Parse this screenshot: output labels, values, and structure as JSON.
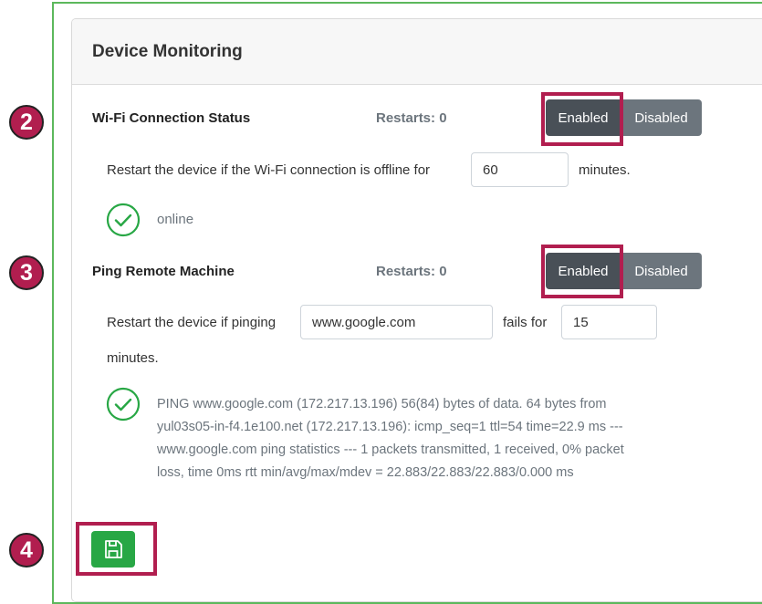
{
  "card": {
    "title": "Device Monitoring"
  },
  "wifi": {
    "title": "Wi-Fi Connection Status",
    "restarts_label": "Restarts: 0",
    "enabled_label": "Enabled",
    "disabled_label": "Disabled",
    "sentence_prefix": "Restart the device if the Wi-Fi connection is offline for",
    "minutes_value": "60",
    "sentence_suffix": "minutes.",
    "status_text": "online"
  },
  "ping": {
    "title": "Ping Remote Machine",
    "restarts_label": "Restarts: 0",
    "enabled_label": "Enabled",
    "disabled_label": "Disabled",
    "sentence_prefix": "Restart the device if pinging",
    "host_value": "www.google.com",
    "fails_label": "fails for",
    "fails_value": "15",
    "minutes_label": "minutes.",
    "result_text": "PING www.google.com (172.217.13.196) 56(84) bytes of data. 64 bytes from yul03s05-in-f4.1e100.net (172.217.13.196): icmp_seq=1 ttl=54 time=22.9 ms --- www.google.com ping statistics --- 1 packets transmitted, 1 received, 0% packet loss, time 0ms rtt min/avg/max/mdev = 22.883/22.883/22.883/0.000 ms"
  },
  "steps": {
    "two": "2",
    "three": "3",
    "four": "4"
  },
  "icons": {
    "status_ok": "check-circle-icon",
    "save": "floppy-disk-icon"
  },
  "colors": {
    "accent_green": "#28a745",
    "highlight": "#b11e4f",
    "button_dark": "#495057",
    "button_gray": "#6c757d"
  }
}
